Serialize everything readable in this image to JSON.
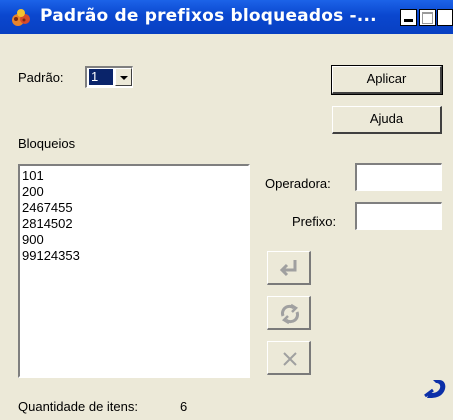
{
  "window": {
    "title": "Padrão de prefixos bloqueados -...",
    "minimize_icon": "minimize-icon",
    "maximize_icon": "maximize-icon",
    "close_glyph": "✕"
  },
  "form": {
    "padrao_label": "Padrão:",
    "padrao_value": "1",
    "bloqueios_label": "Bloqueios",
    "bloqueios": [
      "101",
      "200",
      "2467455",
      "2814502",
      "900",
      "99124353"
    ],
    "operadora_label": "Operadora:",
    "operadora_value": "",
    "prefixo_label": "Prefixo:",
    "prefixo_value": "",
    "quantidade_label": "Quantidade de itens:",
    "quantidade_value": "6"
  },
  "buttons": {
    "aplicar": "Aplicar",
    "ajuda": "Ajuda"
  },
  "icons": {
    "add": "enter-arrow-icon",
    "replace": "refresh-icon",
    "remove": "delete-x-icon",
    "brand": "brand-logo-icon"
  },
  "colors": {
    "titlebar": "#0a47cf",
    "window_bg": "#ece9d8",
    "selection": "#0a246a",
    "brand": "#0b2fa8"
  }
}
